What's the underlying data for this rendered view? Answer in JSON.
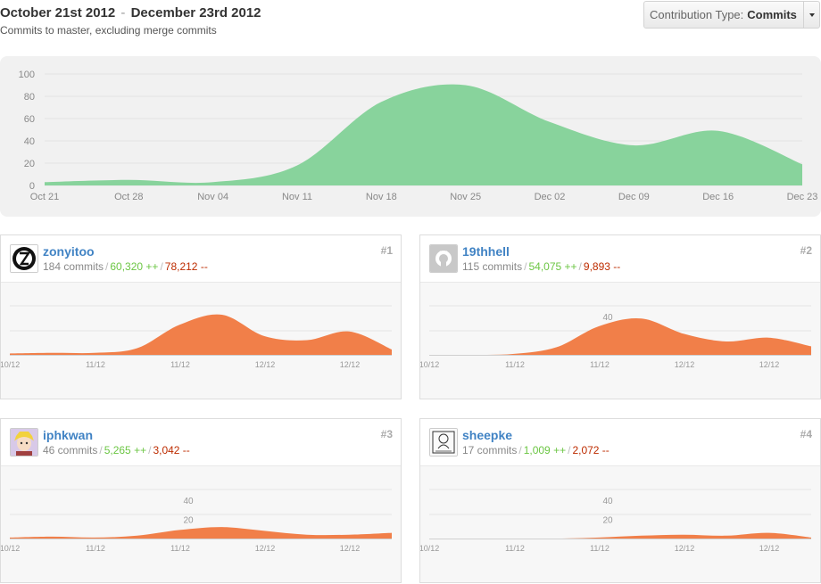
{
  "header": {
    "date_start": "October 21st 2012",
    "date_sep": "-",
    "date_end": "December 23rd 2012",
    "subtitle": "Commits to master, excluding merge commits"
  },
  "contribution_type": {
    "label": "Contribution Type:",
    "value": "Commits"
  },
  "colors": {
    "main_area": "#88d39c",
    "card_area": "#f17f49",
    "link": "#4183c4",
    "additions": "#6cc644",
    "deletions": "#bd2c00"
  },
  "chart_data": [
    {
      "type": "area",
      "x": [
        "Oct 21",
        "Oct 28",
        "Nov 04",
        "Nov 11",
        "Nov 18",
        "Nov 25",
        "Dec 02",
        "Dec 09",
        "Dec 16",
        "Dec 23"
      ],
      "values": [
        3,
        5,
        3,
        18,
        75,
        90,
        57,
        36,
        49,
        19
      ],
      "ylim": [
        0,
        100
      ],
      "yticks": [
        0,
        20,
        40,
        60,
        80,
        100
      ],
      "grid": true
    },
    {
      "type": "area",
      "user": "zonyitoo",
      "x_ticks": [
        "10/12",
        "11/12",
        "11/12",
        "12/12",
        "12/12"
      ],
      "x": [
        "Oct 21",
        "Oct 28",
        "Nov 04",
        "Nov 11",
        "Nov 18",
        "Nov 25",
        "Dec 02",
        "Dec 09",
        "Dec 16",
        "Dec 23"
      ],
      "values": [
        2,
        3,
        3,
        10,
        45,
        60,
        28,
        22,
        35,
        8
      ],
      "ylim": [
        0,
        100
      ]
    },
    {
      "type": "area",
      "user": "19thhell",
      "x_ticks": [
        "10/12",
        "11/12",
        "11/12",
        "12/12",
        "12/12"
      ],
      "yticks": [
        40
      ],
      "x": [
        "Oct 21",
        "Oct 28",
        "Nov 04",
        "Nov 11",
        "Nov 18",
        "Nov 25",
        "Dec 02",
        "Dec 09",
        "Dec 16",
        "Dec 23"
      ],
      "values": [
        0,
        0,
        1,
        8,
        30,
        38,
        22,
        14,
        18,
        9
      ],
      "ylim": [
        0,
        70
      ]
    },
    {
      "type": "area",
      "user": "iphkwan",
      "x_ticks": [
        "10/12",
        "11/12",
        "11/12",
        "12/12",
        "12/12"
      ],
      "yticks": [
        20,
        40
      ],
      "x": [
        "Oct 21",
        "Oct 28",
        "Nov 04",
        "Nov 11",
        "Nov 18",
        "Nov 25",
        "Dec 02",
        "Dec 09",
        "Dec 16",
        "Dec 23"
      ],
      "values": [
        1,
        2,
        1,
        3,
        9,
        12,
        8,
        4,
        4,
        6
      ],
      "ylim": [
        0,
        70
      ]
    },
    {
      "type": "area",
      "user": "sheepke",
      "x_ticks": [
        "10/12",
        "11/12",
        "11/12",
        "12/12",
        "12/12"
      ],
      "yticks": [
        20,
        40
      ],
      "x": [
        "Oct 21",
        "Oct 28",
        "Nov 04",
        "Nov 11",
        "Nov 18",
        "Nov 25",
        "Dec 02",
        "Dec 09",
        "Dec 16",
        "Dec 23"
      ],
      "values": [
        0,
        0,
        0,
        0,
        1,
        3,
        4,
        3,
        6,
        1
      ],
      "ylim": [
        0,
        70
      ]
    }
  ],
  "contributors": [
    {
      "name": "zonyitoo",
      "rank": "#1",
      "commits": "184 commits",
      "additions": "60,320 ++",
      "deletions": "78,212 --",
      "avatar_icon": "geometric-avatar-icon"
    },
    {
      "name": "19thhell",
      "rank": "#2",
      "commits": "115 commits",
      "additions": "54,075 ++",
      "deletions": "9,893 --",
      "avatar_icon": "octocat-icon"
    },
    {
      "name": "iphkwan",
      "rank": "#3",
      "commits": "46 commits",
      "additions": "5,265 ++",
      "deletions": "3,042 --",
      "avatar_icon": "anime-avatar-icon"
    },
    {
      "name": "sheepke",
      "rank": "#4",
      "commits": "17 commits",
      "additions": "1,009 ++",
      "deletions": "2,072 --",
      "avatar_icon": "sketch-avatar-icon"
    }
  ]
}
